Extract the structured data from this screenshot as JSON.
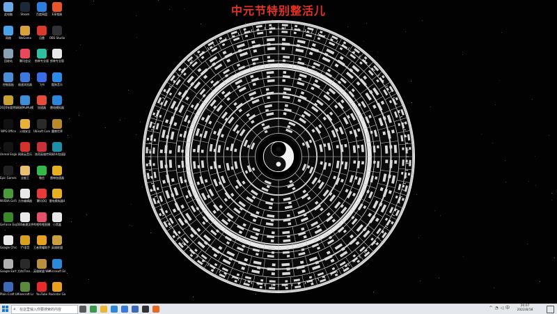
{
  "title": "中元节特别整活儿",
  "colors": {
    "title": "#e8321e",
    "desktop_bg": "#020202",
    "taskbar_bg": "#e4e7ec",
    "accent": "#1b78d6"
  },
  "desktop_icons": [
    {
      "label": "此电脑",
      "color": "#6aa9e8",
      "icon": "computer-icon"
    },
    {
      "label": "Steam",
      "color": "#1b2838",
      "icon": "steam-icon"
    },
    {
      "label": "百度网盘",
      "color": "#2b7fe0",
      "icon": "cloud-icon"
    },
    {
      "label": "E享相册",
      "color": "#e8552c",
      "icon": "photo-icon"
    },
    {
      "label": "网络",
      "color": "#4aa3e8",
      "icon": "network-icon"
    },
    {
      "label": "WeGame",
      "color": "#d8a13a",
      "icon": "wegame-icon"
    },
    {
      "label": "迅雷",
      "color": "#d93a2c",
      "icon": "thunder-icon"
    },
    {
      "label": "OBS Studio",
      "color": "#303035",
      "icon": "obs-icon"
    },
    {
      "label": "回收站",
      "color": "#8aa0b4",
      "icon": "recycle-bin-icon"
    },
    {
      "label": "腾讯会议",
      "color": "#e8485a",
      "icon": "meeting-icon"
    },
    {
      "label": "剪映专业版",
      "color": "#2fbfa0",
      "icon": "video-editor-icon"
    },
    {
      "label": "剪映专业版",
      "color": "#e8e8e8",
      "icon": "capcut-icon"
    },
    {
      "label": "控制面板",
      "color": "#4a8fd6",
      "icon": "control-panel-icon"
    },
    {
      "label": "极速浏览器",
      "color": "#3a7ae0",
      "icon": "browser-icon"
    },
    {
      "label": "飞书",
      "color": "#3b6ce8",
      "icon": "feishu-icon"
    },
    {
      "label": "酷狗音乐",
      "color": "#2a8ae8",
      "icon": "music-icon"
    },
    {
      "label": "2020年度特辑V3",
      "color": "#c8a230",
      "icon": "folder-icon"
    },
    {
      "label": "网易MuMu模拟器",
      "color": "#3b8fd8",
      "icon": "emulator-icon"
    },
    {
      "label": "加速器",
      "color": "#e84a3a",
      "icon": "speedup-icon"
    },
    {
      "label": "雷电模拟器",
      "color": "#2b85d8",
      "icon": "ldplayer-icon"
    },
    {
      "label": "WPS Office",
      "color": "#111111",
      "icon": "wps-icon"
    },
    {
      "label": "火绒安全",
      "color": "#e8b23a",
      "icon": "security-icon"
    },
    {
      "label": "Ubisoft Connect",
      "color": "#2a2a2a",
      "icon": "ubisoft-icon"
    },
    {
      "label": "魔兽世界",
      "color": "#b88a2a",
      "icon": "wow-icon"
    },
    {
      "label": "Unreal Engine",
      "color": "#141414",
      "icon": "unreal-icon"
    },
    {
      "label": "网易云音乐",
      "color": "#d8302c",
      "icon": "netease-music-icon"
    },
    {
      "label": "洛奇英雄传",
      "color": "#c8303a",
      "icon": "game-icon"
    },
    {
      "label": "网易UU加速器",
      "color": "#1f8fa8",
      "icon": "uu-icon"
    },
    {
      "label": "Epic Games Launcher",
      "color": "#202020",
      "icon": "epic-icon"
    },
    {
      "label": "全能王",
      "color": "#e8c070",
      "icon": "document-icon"
    },
    {
      "label": "微信",
      "color": "#33b84a",
      "icon": "wechat-icon"
    },
    {
      "label": "雷神加速器",
      "color": "#e8b020",
      "icon": "leishen-icon"
    },
    {
      "label": "NVIDIA GeForce",
      "color": "#4a9a3a",
      "icon": "nvidia-icon"
    },
    {
      "label": "方舟编辑器",
      "color": "#e8e8e8",
      "icon": "doc-icon"
    },
    {
      "label": "腾讯QQ",
      "color": "#e83a3a",
      "icon": "qq-icon"
    },
    {
      "label": "雷电模拟器4",
      "color": "#e8b020",
      "icon": "ld4-icon"
    },
    {
      "label": "GeForce Experience",
      "color": "#3a8a2a",
      "icon": "geforce-icon"
    },
    {
      "label": "OBS新建文件",
      "color": "#e8e8e8",
      "icon": "file-icon"
    },
    {
      "label": "哔哩哔哩直播姬",
      "color": "#e8506a",
      "icon": "bilibili-icon"
    },
    {
      "label": "小黑盒",
      "color": "#e8e8e8",
      "icon": "heybox-icon"
    },
    {
      "label": "Google Chrome",
      "color": "#e8e8e8",
      "icon": "chrome-icon"
    },
    {
      "label": "YY语音",
      "color": "#d8a020",
      "icon": "yy-icon"
    },
    {
      "label": "王者荣耀助手",
      "color": "#e8a020",
      "icon": "helper-icon"
    },
    {
      "label": "英雄联盟",
      "color": "#c8a040",
      "icon": "lol-icon"
    },
    {
      "label": "Google Earth Pro",
      "color": "#b0b0b0",
      "icon": "earth-icon"
    },
    {
      "label": "方舟(Tran...",
      "color": "#2a2a2a",
      "icon": "ark-icon"
    },
    {
      "label": "英雄联盟 WeGame版",
      "color": "#b89040",
      "icon": "lol-wegame-icon"
    },
    {
      "label": "Microsoft Edge",
      "color": "#2a8ad8",
      "icon": "edge-icon"
    },
    {
      "label": "Plain Craft Launcher",
      "color": "#3a6ab8",
      "icon": "pcl-icon"
    },
    {
      "label": "Minecraft Launcher",
      "color": "#5a8a3a",
      "icon": "minecraft-icon"
    },
    {
      "label": "YouTube",
      "color": "#e82a2a",
      "icon": "youtube-icon"
    },
    {
      "label": "Rockstar Games...",
      "color": "#e8a020",
      "icon": "rockstar-icon"
    }
  ],
  "taskbar": {
    "search_placeholder": "在这里输入你要搜索的内容",
    "apps": [
      {
        "name": "task-view",
        "color": "#5a5a5a"
      },
      {
        "name": "chrome",
        "color": "#3a9a4a"
      },
      {
        "name": "explorer",
        "color": "#e8b830"
      },
      {
        "name": "edge",
        "color": "#2a8ad8"
      },
      {
        "name": "store",
        "color": "#3a7ad8"
      },
      {
        "name": "mail",
        "color": "#3a6ab8"
      },
      {
        "name": "obs",
        "color": "#303035"
      },
      {
        "name": "media",
        "color": "#e86a20"
      }
    ],
    "time": "20:07",
    "date": "2022/8/18"
  }
}
